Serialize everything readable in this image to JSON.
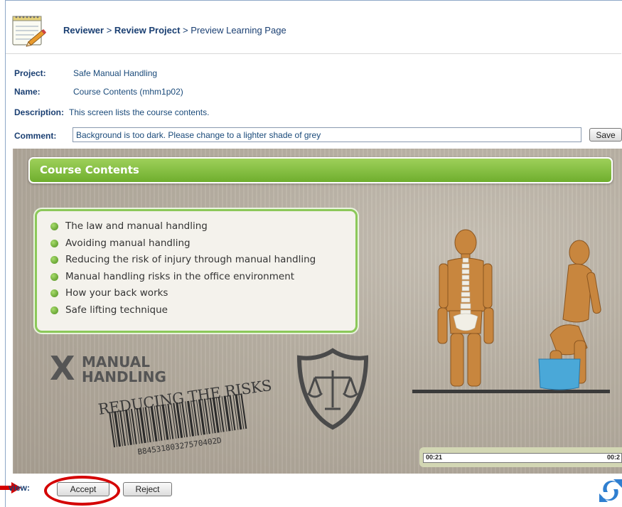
{
  "breadcrumb": {
    "item1": "Reviewer",
    "sep1": " > ",
    "item2": "Review Project",
    "sep2": " > ",
    "current": "Preview Learning Page"
  },
  "details": {
    "project_label": "Project:",
    "project_value": "Safe Manual Handling",
    "name_label": "Name:",
    "name_value": "Course Contents (mhm1p02)",
    "description_label": "Description:",
    "description_value": "This screen lists the course contents.",
    "comment_label": "Comment:",
    "comment_value": "Background is too dark. Please change to a lighter shade of grey"
  },
  "save_label": "Save",
  "slide": {
    "title": "Course Contents",
    "items": [
      "The law and manual handling",
      "Avoiding manual handling",
      "Reducing the risk of injury through manual handling",
      "Manual handling risks in the office environment",
      "How your back works",
      "Safe lifting technique"
    ],
    "logo_x": "X",
    "logo_line1": "MANUAL",
    "logo_line2": "HANDLING",
    "tagline": "REDUCING THE RISKS",
    "barcode_number": "B8453180327570402D",
    "player": {
      "time_current": "00:21",
      "time_total": "00:2"
    }
  },
  "review": {
    "label": "view:",
    "accept_label": "Accept",
    "reject_label": "Reject"
  },
  "colors": {
    "accent_green": "#7ab83a",
    "link_blue": "#1a3f72",
    "annotation_red": "#d40000"
  },
  "icons": {
    "header": "notepad-pencil-icon",
    "refresh": "refresh-icon",
    "annotation": "arrow-right-icon"
  }
}
